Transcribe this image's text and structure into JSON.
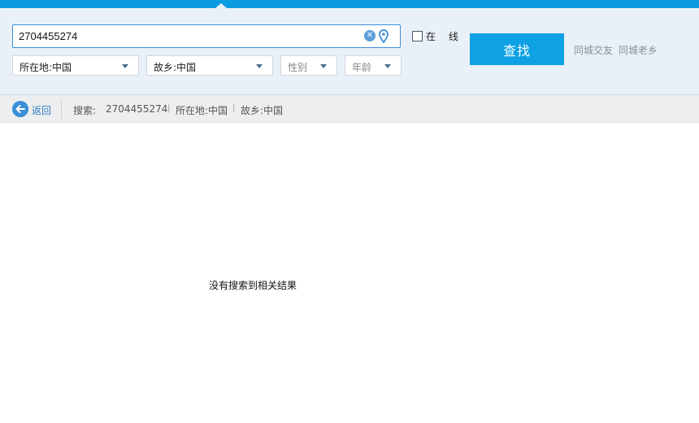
{
  "search": {
    "query": "2704455274",
    "online_label": "在 线",
    "online_checked": false,
    "find_label": "查找"
  },
  "filters": {
    "location": "所在地:中国",
    "hometown": "故乡:中国",
    "gender": "性别",
    "age": "年龄"
  },
  "links": {
    "same_city_friends": "同城交友",
    "same_city_hometown": "同城老乡"
  },
  "breadcrumb": {
    "back_label": "返回",
    "search_prefix": "搜索:",
    "query": "2704455274",
    "separator": "|",
    "location": "所在地:中国",
    "hometown": "故乡:中国"
  },
  "result": {
    "empty_message": "没有搜索到相关结果"
  },
  "colors": {
    "accent": "#0b9be0",
    "button": "#0ea1e4",
    "panel_bg": "#eaf0f8"
  }
}
